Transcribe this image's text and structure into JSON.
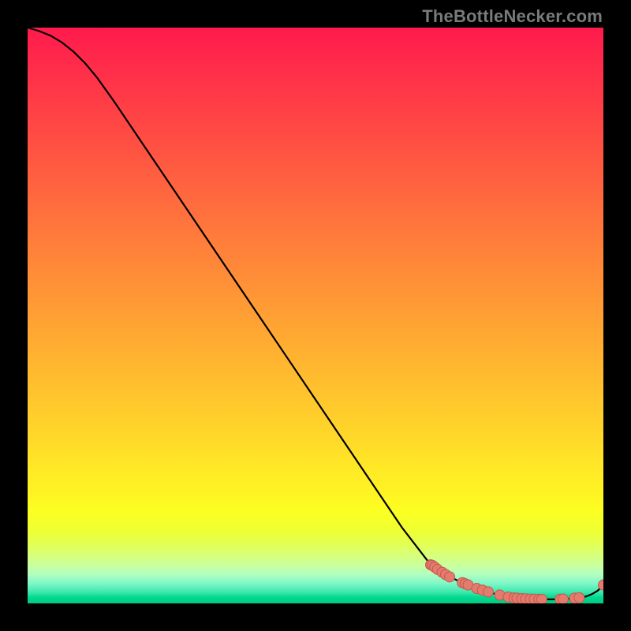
{
  "watermark": "TheBottleNecker.com",
  "colors": {
    "line": "#000000",
    "dot_fill": "#e37b6f",
    "dot_stroke": "#c9574a"
  },
  "chart_data": {
    "type": "line",
    "title": "",
    "xlabel": "",
    "ylabel": "",
    "xlim": [
      0,
      100
    ],
    "ylim": [
      0,
      100
    ],
    "series": [
      {
        "name": "curve",
        "x": [
          0,
          2,
          4,
          6,
          8,
          10,
          12,
          15,
          20,
          25,
          30,
          35,
          40,
          45,
          50,
          55,
          60,
          65,
          70,
          71,
          73,
          75,
          77,
          79,
          81,
          83,
          84,
          85.5,
          87,
          88.5,
          90,
          91.5,
          93,
          94.5,
          96,
          97,
          98,
          99,
          100
        ],
        "y": [
          100,
          99.4,
          98.6,
          97.4,
          95.8,
          93.8,
          91.4,
          87.2,
          79.8,
          72.4,
          65.0,
          57.6,
          50.2,
          42.8,
          35.4,
          28.0,
          20.6,
          13.2,
          6.7,
          6.0,
          4.8,
          3.8,
          3.0,
          2.3,
          1.7,
          1.2,
          1.0,
          0.85,
          0.75,
          0.7,
          0.7,
          0.7,
          0.75,
          0.85,
          1.0,
          1.2,
          1.6,
          2.2,
          3.2
        ]
      }
    ],
    "marker_points": [
      {
        "x": 70.0,
        "y": 6.7
      },
      {
        "x": 70.3,
        "y": 6.6
      },
      {
        "x": 70.7,
        "y": 6.3
      },
      {
        "x": 71.2,
        "y": 5.9
      },
      {
        "x": 72.0,
        "y": 5.4
      },
      {
        "x": 72.6,
        "y": 5.0
      },
      {
        "x": 73.3,
        "y": 4.6
      },
      {
        "x": 75.5,
        "y": 3.6
      },
      {
        "x": 76.0,
        "y": 3.4
      },
      {
        "x": 76.5,
        "y": 3.2
      },
      {
        "x": 78.0,
        "y": 2.6
      },
      {
        "x": 79.0,
        "y": 2.3
      },
      {
        "x": 80.0,
        "y": 2.0
      },
      {
        "x": 82.0,
        "y": 1.45
      },
      {
        "x": 83.5,
        "y": 1.1
      },
      {
        "x": 84.5,
        "y": 0.95
      },
      {
        "x": 85.0,
        "y": 0.9
      },
      {
        "x": 85.8,
        "y": 0.82
      },
      {
        "x": 86.5,
        "y": 0.78
      },
      {
        "x": 87.3,
        "y": 0.74
      },
      {
        "x": 88.0,
        "y": 0.72
      },
      {
        "x": 88.8,
        "y": 0.7
      },
      {
        "x": 89.3,
        "y": 0.7
      },
      {
        "x": 92.5,
        "y": 0.72
      },
      {
        "x": 93.0,
        "y": 0.75
      },
      {
        "x": 95.0,
        "y": 0.9
      },
      {
        "x": 95.8,
        "y": 0.98
      },
      {
        "x": 100.0,
        "y": 3.2
      }
    ]
  }
}
